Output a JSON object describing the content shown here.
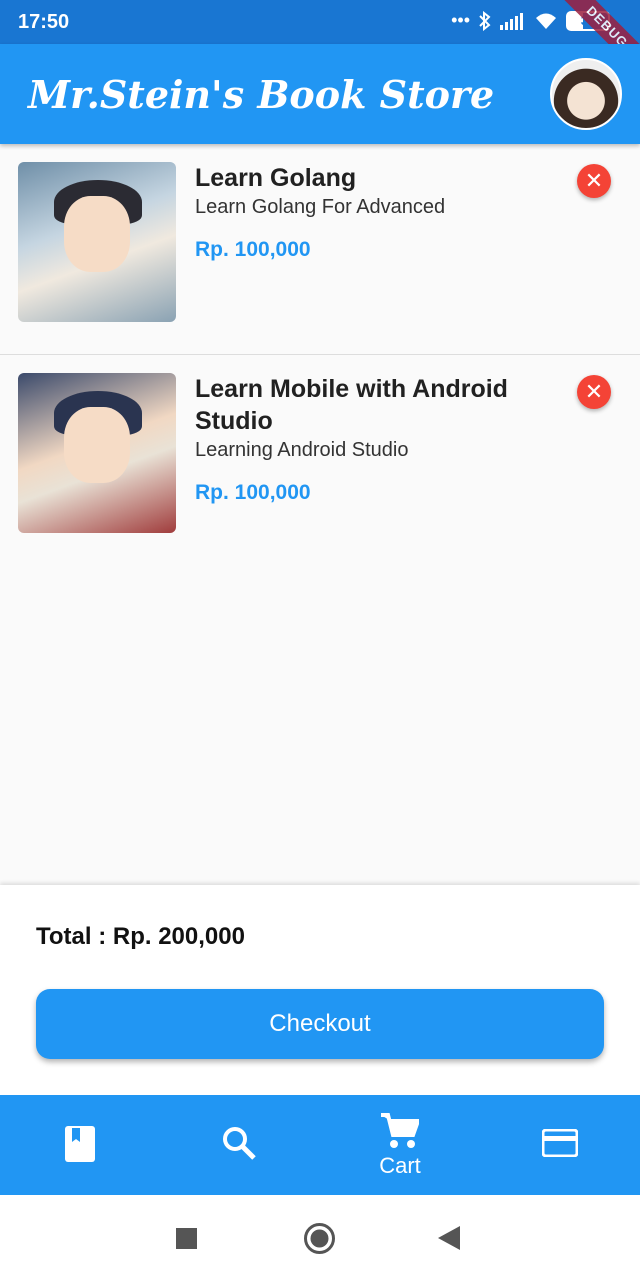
{
  "status_bar": {
    "time": "17:50",
    "battery": "37",
    "debug_label": "DEBUG"
  },
  "app_bar": {
    "title": "Mr.Stein's Book Store"
  },
  "cart_items": [
    {
      "title": "Learn  Golang",
      "subtitle": "Learn Golang For Advanced",
      "price": "Rp. 100,000"
    },
    {
      "title": "Learn  Mobile with Android Studio",
      "subtitle": "Learning Android Studio",
      "price": "Rp. 100,000"
    }
  ],
  "summary": {
    "total": "Total : Rp. 200,000",
    "checkout_label": "Checkout"
  },
  "bottom_nav": {
    "active_label": "Cart"
  },
  "colors": {
    "primary": "#2196f3",
    "status_bar": "#1976d2",
    "delete": "#f44336"
  }
}
